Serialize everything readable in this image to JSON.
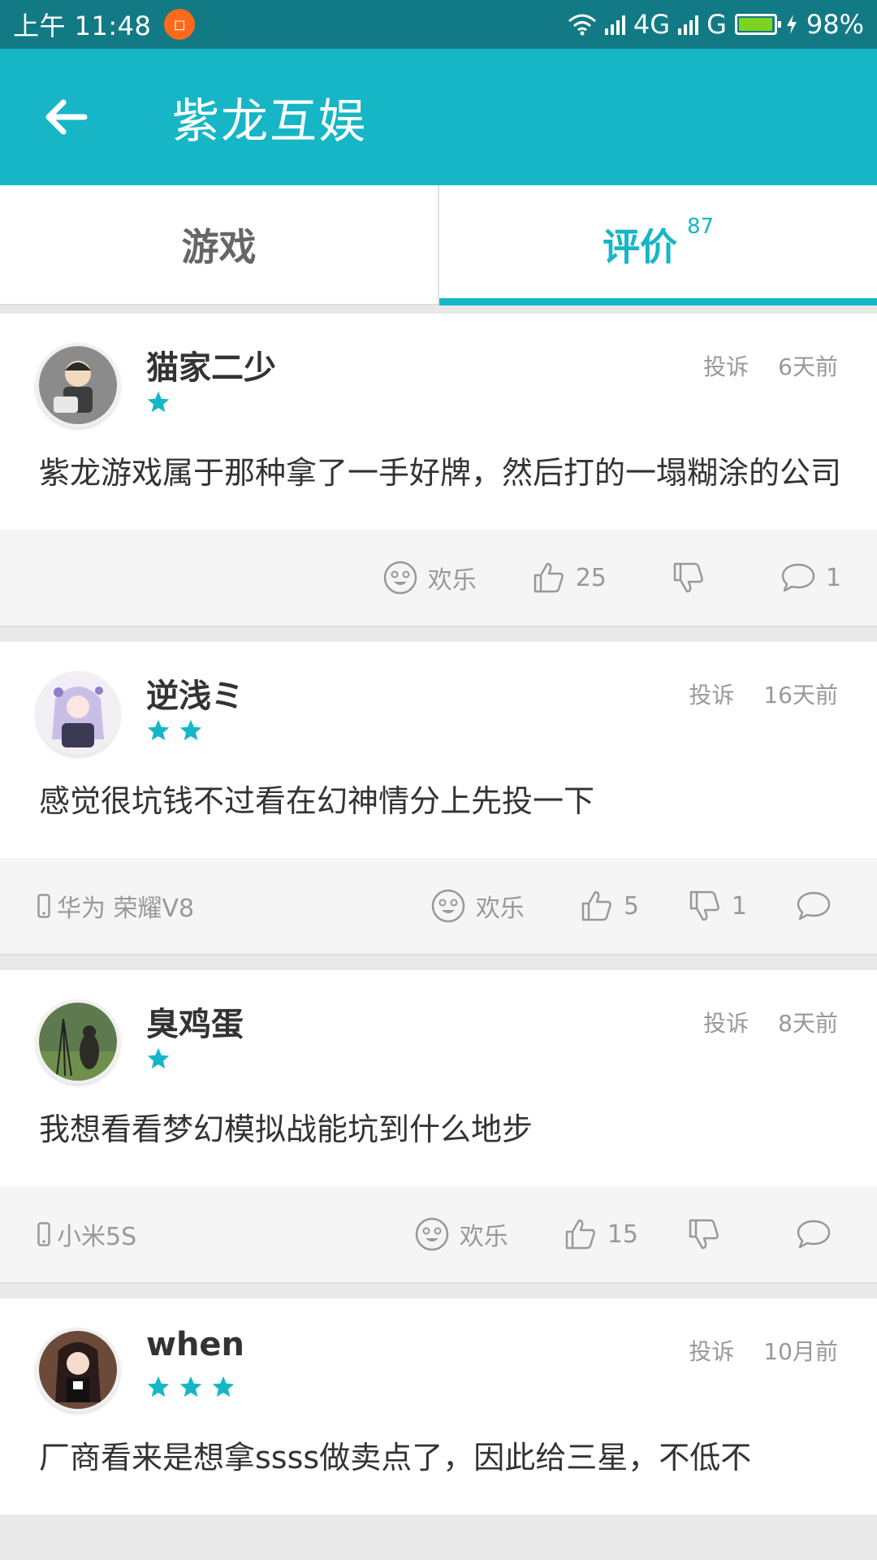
{
  "status_bar": {
    "time": "上午 11:48",
    "network": "4G",
    "network2": "G",
    "battery": "98%",
    "battery_level": 0.98
  },
  "app_bar": {
    "title": "紫龙互娱"
  },
  "tabs": [
    {
      "label": "游戏",
      "count": "",
      "active": false
    },
    {
      "label": "评价",
      "count": "87",
      "active": true
    }
  ],
  "reviews": [
    {
      "name": "猫家二少",
      "stars": 1,
      "report": "投诉",
      "time": "6天前",
      "text": "紫龙游戏属于那种拿了一手好牌，然后打的一塌糊涂的公司",
      "device": "",
      "mood": "欢乐",
      "likes": "25",
      "dislikes": "",
      "comments": "1"
    },
    {
      "name": "逆浅ミ",
      "stars": 2,
      "report": "投诉",
      "time": "16天前",
      "text": "感觉很坑钱不过看在幻神情分上先投一下",
      "device": "华为 荣耀V8",
      "mood": "欢乐",
      "likes": "5",
      "dislikes": "1",
      "comments": ""
    },
    {
      "name": "臭鸡蛋",
      "stars": 1,
      "report": "投诉",
      "time": "8天前",
      "text": "我想看看梦幻模拟战能坑到什么地步",
      "device": "小米5S",
      "mood": "欢乐",
      "likes": "15",
      "dislikes": "",
      "comments": ""
    },
    {
      "name": "when",
      "stars": 3,
      "report": "投诉",
      "time": "10月前",
      "text": "厂商看来是想拿ssss做卖点了，因此给三星，不低不",
      "device": "",
      "mood": "",
      "likes": "",
      "dislikes": "",
      "comments": ""
    }
  ],
  "colors": {
    "accent": "#16b6c6",
    "status_bar": "#127a85",
    "text_muted": "#999999"
  },
  "icons": {
    "back": "arrow-left-icon",
    "star": "star-icon",
    "mood": "smiley-icon",
    "like": "thumbs-up-icon",
    "dislike": "thumbs-down-icon",
    "comment": "chat-bubble-icon",
    "device": "phone-icon"
  }
}
